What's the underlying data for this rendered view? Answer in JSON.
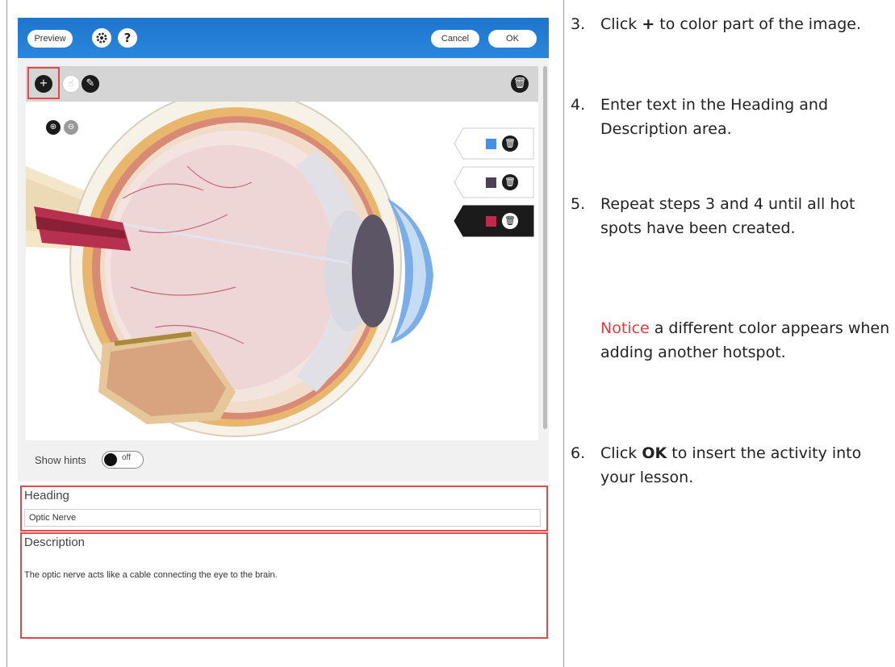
{
  "titlebar": {
    "preview_label": "Preview",
    "settings_icon": "gear-icon",
    "help_label": "?",
    "cancel_label": "Cancel",
    "ok_label": "OK",
    "bar_color": "#1e74cd"
  },
  "toolbar": {
    "add_label": "+",
    "add_icon": "plus-icon",
    "select_icon": "hand-icon",
    "edit_icon": "pencil-icon",
    "delete_icon": "trash-icon"
  },
  "zoom": {
    "in_icon": "zoom-in-icon",
    "out_icon": "zoom-out-icon"
  },
  "hotspots": [
    {
      "color": "#4a90e2",
      "active": false,
      "delete_icon": "trash-icon"
    },
    {
      "color": "#4b4259",
      "active": false,
      "delete_icon": "trash-icon"
    },
    {
      "color": "#c2294e",
      "active": true,
      "delete_icon": "trash-icon"
    }
  ],
  "hints": {
    "label": "Show hints",
    "toggle_text": "off",
    "enabled": false
  },
  "heading": {
    "label": "Heading",
    "value": "Optic Nerve"
  },
  "description": {
    "label": "Description",
    "value": "The optic nerve acts like a cable connecting the eye to the brain."
  },
  "instructions": {
    "step3": {
      "num": "3.",
      "pre": "Click ",
      "bold": "+",
      "post": " to color part of the image."
    },
    "step4": {
      "num": "4.",
      "text": "Enter text in the Heading and Description area."
    },
    "step5": {
      "num": "5.",
      "text": "Repeat steps 3 and 4 until all hot spots have been created."
    },
    "notice": {
      "red": "Notice",
      "rest": " a different color appears when adding another hotspot."
    },
    "step6": {
      "num": "6.",
      "pre": "Click ",
      "bold": "OK",
      "post": " to insert the activity into your lesson."
    }
  },
  "accent_red": "#e04a4a"
}
